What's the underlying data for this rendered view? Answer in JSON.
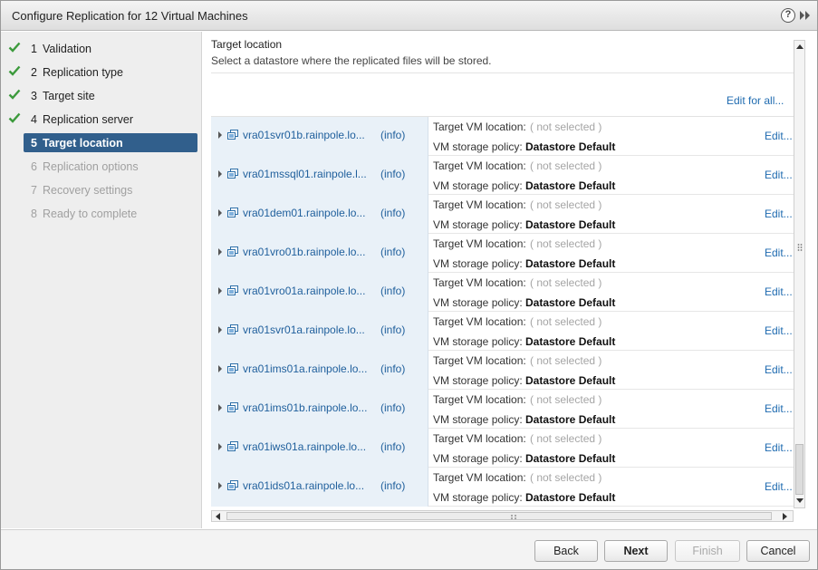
{
  "window": {
    "title": "Configure Replication for 12 Virtual Machines"
  },
  "steps": [
    {
      "num": "1",
      "label": "Validation",
      "state": "done"
    },
    {
      "num": "2",
      "label": "Replication type",
      "state": "done"
    },
    {
      "num": "3",
      "label": "Target site",
      "state": "done"
    },
    {
      "num": "4",
      "label": "Replication server",
      "state": "done"
    },
    {
      "num": "5",
      "label": "Target location",
      "state": "active"
    },
    {
      "num": "6",
      "label": "Replication options",
      "state": "pending"
    },
    {
      "num": "7",
      "label": "Recovery settings",
      "state": "pending"
    },
    {
      "num": "8",
      "label": "Ready to complete",
      "state": "pending"
    }
  ],
  "content": {
    "heading": "Target location",
    "description": "Select a datastore where the replicated files will be stored.",
    "edit_all": "Edit for all..."
  },
  "row_labels": {
    "info": "(info)",
    "location_label": "Target VM location:",
    "location_value": "( not selected )",
    "policy_label": "VM storage policy:",
    "policy_value": "Datastore Default",
    "edit": "Edit..."
  },
  "vms": [
    "vra01svr01b.rainpole.lo...",
    "vra01mssql01.rainpole.l...",
    "vra01dem01.rainpole.lo...",
    "vra01vro01b.rainpole.lo...",
    "vra01vro01a.rainpole.lo...",
    "vra01svr01a.rainpole.lo...",
    "vra01ims01a.rainpole.lo...",
    "vra01ims01b.rainpole.lo...",
    "vra01iws01a.rainpole.lo...",
    "vra01ids01a.rainpole.lo..."
  ],
  "footer": {
    "back": "Back",
    "next": "Next",
    "finish": "Finish",
    "cancel": "Cancel"
  },
  "colors": {
    "accent": "#315f8c",
    "link": "#1f6bb0",
    "check": "#3c9a3c"
  },
  "icons": [
    "help-icon",
    "expand-icon",
    "checkmark-icon",
    "vm-icon",
    "expand-caret-icon"
  ]
}
